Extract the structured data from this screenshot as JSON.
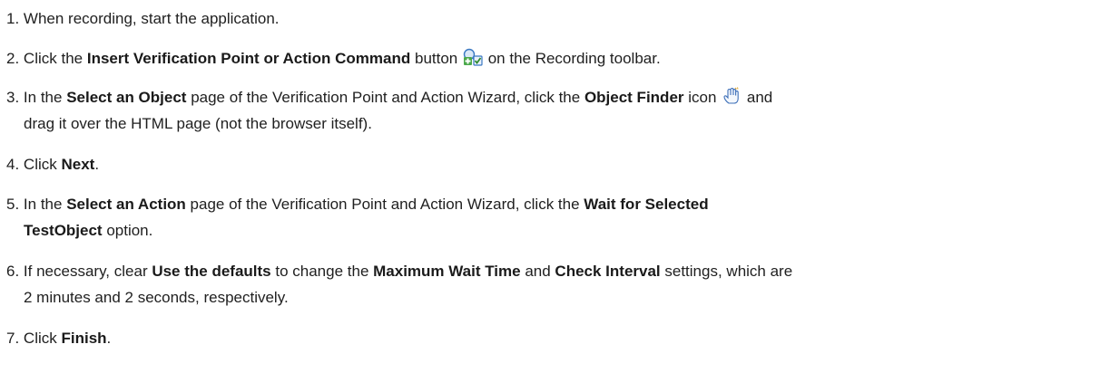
{
  "steps": [
    {
      "num": "1.",
      "parts": [
        "When recording, start the application."
      ]
    },
    {
      "num": "2.",
      "pre": "Click the ",
      "b1": "Insert Verification Point or Action Command",
      "mid": " button ",
      "icon": "insert-verification-point-icon",
      "post": " on the Recording toolbar."
    },
    {
      "num": "3.",
      "pre": "In the ",
      "b1": "Select an Object",
      "mid1": " page of the Verification Point and Action Wizard, click the ",
      "b2": "Object Finder",
      "mid2": " icon ",
      "icon": "object-finder-hand-icon",
      "post1": " and",
      "line2": "drag it over the HTML page (not the browser itself)."
    },
    {
      "num": "4.",
      "pre": "Click ",
      "b1": "Next",
      "post": "."
    },
    {
      "num": "5.",
      "pre": "In the ",
      "b1": "Select an Action",
      "mid1": " page of the Verification Point and Action Wizard, click the ",
      "b2": "Wait for Selected",
      "line2_b": "TestObject",
      "line2_post": " option."
    },
    {
      "num": "6.",
      "pre": "If necessary, clear ",
      "b1": "Use the defaults",
      "mid1": " to change the ",
      "b2": "Maximum Wait Time",
      "mid2": " and ",
      "b3": "Check Interval",
      "post1": " settings, which are",
      "line2": "2 minutes and 2 seconds, respectively."
    },
    {
      "num": "7.",
      "pre": "Click ",
      "b1": "Finish",
      "post": "."
    }
  ],
  "colors": {
    "text": "#1f1f1f",
    "icon_green": "#4aa84a",
    "icon_blue": "#3a78c2",
    "hand_outline": "#3d6fb8"
  }
}
